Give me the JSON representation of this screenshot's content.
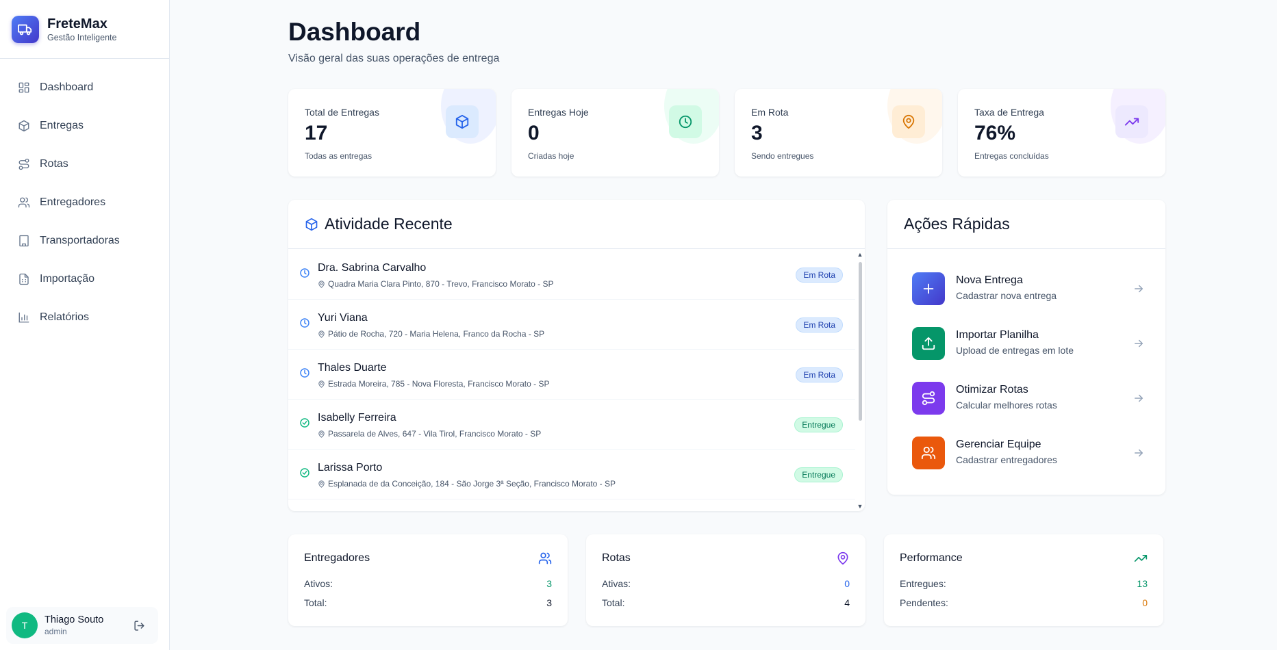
{
  "brand": {
    "name": "FreteMax",
    "subtitle": "Gestão Inteligente",
    "color": "#4338ca"
  },
  "nav": {
    "items": [
      {
        "label": "Dashboard",
        "icon": "layout-grid-icon"
      },
      {
        "label": "Entregas",
        "icon": "package-icon"
      },
      {
        "label": "Rotas",
        "icon": "route-icon"
      },
      {
        "label": "Entregadores",
        "icon": "users-icon"
      },
      {
        "label": "Transportadoras",
        "icon": "building-icon"
      },
      {
        "label": "Importação",
        "icon": "file-spreadsheet-icon"
      },
      {
        "label": "Relatórios",
        "icon": "bar-chart-icon"
      }
    ]
  },
  "user": {
    "initial": "T",
    "name": "Thiago Souto",
    "role": "admin",
    "avatar_color": "#10b981"
  },
  "header": {
    "title": "Dashboard",
    "subtitle": "Visão geral das suas operações de entrega"
  },
  "stats": [
    {
      "label": "Total de Entregas",
      "value": "17",
      "desc": "Todas as entregas",
      "icon": "package-icon",
      "color": "#2563eb"
    },
    {
      "label": "Entregas Hoje",
      "value": "0",
      "desc": "Criadas hoje",
      "icon": "clock-icon",
      "color": "#059669"
    },
    {
      "label": "Em Rota",
      "value": "3",
      "desc": "Sendo entregues",
      "icon": "map-pin-icon",
      "color": "#d97706"
    },
    {
      "label": "Taxa de Entrega",
      "value": "76%",
      "desc": "Entregas concluídas",
      "icon": "trending-up-icon",
      "color": "#7c3aed"
    }
  ],
  "activity": {
    "title": "Atividade Recente",
    "items": [
      {
        "name": "Dra. Sabrina Carvalho",
        "address": "Quadra Maria Clara Pinto, 870 - Trevo, Francisco Morato - SP",
        "status": "Em Rota"
      },
      {
        "name": "Yuri Viana",
        "address": "Pátio de Rocha, 720 - Maria Helena, Franco da Rocha - SP",
        "status": "Em Rota"
      },
      {
        "name": "Thales Duarte",
        "address": "Estrada Moreira, 785 - Nova Floresta, Francisco Morato - SP",
        "status": "Em Rota"
      },
      {
        "name": "Isabelly Ferreira",
        "address": "Passarela de Alves, 647 - Vila Tirol, Francisco Morato - SP",
        "status": "Entregue"
      },
      {
        "name": "Larissa Porto",
        "address": "Esplanada de da Conceição, 184 - São Jorge 3ª Seção, Francisco Morato - SP",
        "status": "Entregue"
      }
    ]
  },
  "quick_actions": {
    "title": "Ações Rápidas",
    "items": [
      {
        "title": "Nova Entrega",
        "subtitle": "Cadastrar nova entrega",
        "icon": "plus-icon",
        "color": "#4f46e5"
      },
      {
        "title": "Importar Planilha",
        "subtitle": "Upload de entregas em lote",
        "icon": "upload-icon",
        "color": "#059669"
      },
      {
        "title": "Otimizar Rotas",
        "subtitle": "Calcular melhores rotas",
        "icon": "route-icon",
        "color": "#7c3aed"
      },
      {
        "title": "Gerenciar Equipe",
        "subtitle": "Cadastrar entregadores",
        "icon": "users-icon",
        "color": "#ea580c"
      }
    ]
  },
  "summary": [
    {
      "title": "Entregadores",
      "icon": "users-icon",
      "rows": [
        {
          "label": "Ativos:",
          "value": "3",
          "color": "#059669"
        },
        {
          "label": "Total:",
          "value": "3",
          "color": "#0f172a"
        }
      ]
    },
    {
      "title": "Rotas",
      "icon": "map-pin-icon",
      "rows": [
        {
          "label": "Ativas:",
          "value": "0",
          "color": "#2563eb"
        },
        {
          "label": "Total:",
          "value": "4",
          "color": "#0f172a"
        }
      ]
    },
    {
      "title": "Performance",
      "icon": "trending-up-icon",
      "rows": [
        {
          "label": "Entregues:",
          "value": "13",
          "color": "#059669"
        },
        {
          "label": "Pendentes:",
          "value": "0",
          "color": "#d97706"
        }
      ]
    }
  ]
}
